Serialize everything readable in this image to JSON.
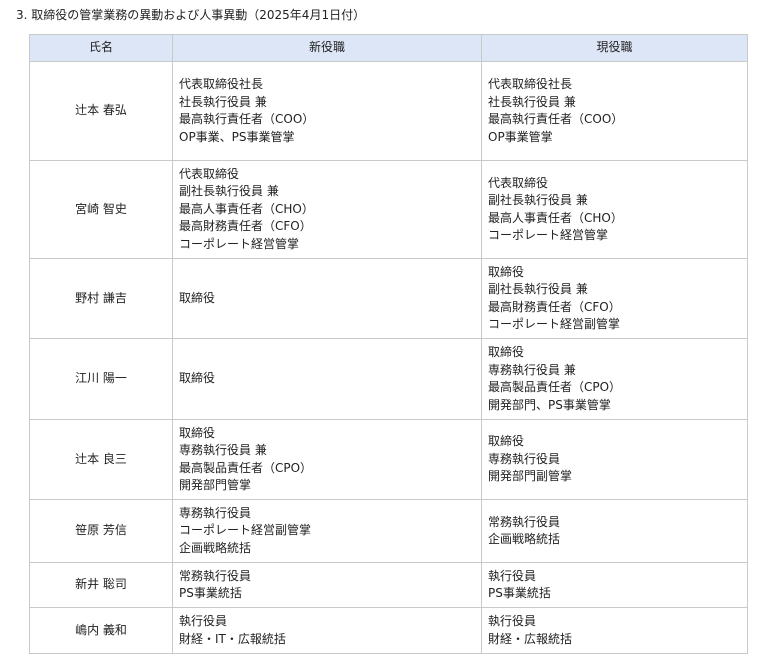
{
  "heading": "3. 取締役の管掌業務の異動および人事異動（2025年4月1日付）",
  "table": {
    "headers": [
      "氏名",
      "新役職",
      "現役職"
    ],
    "rows": [
      {
        "name": "辻本 春弘",
        "new": [
          "代表取締役社長",
          "社長執行役員 兼",
          "最高執行責任者（COO）",
          "OP事業、PS事業管掌"
        ],
        "current": [
          "代表取締役社長",
          "社長執行役員 兼",
          "最高執行責任者（COO）",
          "OP事業管掌"
        ]
      },
      {
        "name": "宮崎 智史",
        "new": [
          "代表取締役",
          "副社長執行役員 兼",
          "最高人事責任者（CHO）",
          "最高財務責任者（CFO）",
          "コーポレート経営管掌"
        ],
        "current": [
          "代表取締役",
          "副社長執行役員 兼",
          "最高人事責任者（CHO）",
          "コーポレート経営管掌"
        ]
      },
      {
        "name": "野村 謙吉",
        "new": [
          "取締役"
        ],
        "current": [
          "取締役",
          "副社長執行役員 兼",
          "最高財務責任者（CFO）",
          "コーポレート経営副管掌"
        ]
      },
      {
        "name": "江川 陽一",
        "new": [
          "取締役"
        ],
        "current": [
          "取締役",
          "専務執行役員 兼",
          "最高製品責任者（CPO）",
          "開発部門、PS事業管掌"
        ]
      },
      {
        "name": "辻本 良三",
        "new": [
          "取締役",
          "専務執行役員 兼",
          "最高製品責任者（CPO）",
          "開発部門管掌"
        ],
        "current": [
          "取締役",
          "専務執行役員",
          "開発部門副管掌"
        ]
      },
      {
        "name": "笹原 芳信",
        "new": [
          "専務執行役員",
          "コーポレート経営副管掌",
          "企画戦略統括"
        ],
        "current": [
          "常務執行役員",
          "企画戦略統括"
        ]
      },
      {
        "name": "新井 聡司",
        "new": [
          "常務執行役員",
          "PS事業統括"
        ],
        "current": [
          "執行役員",
          "PS事業統括"
        ]
      },
      {
        "name": "嶋内 義和",
        "new": [
          "執行役員",
          "財経・IT・広報統括"
        ],
        "current": [
          "執行役員",
          "財経・広報統括"
        ]
      }
    ]
  }
}
